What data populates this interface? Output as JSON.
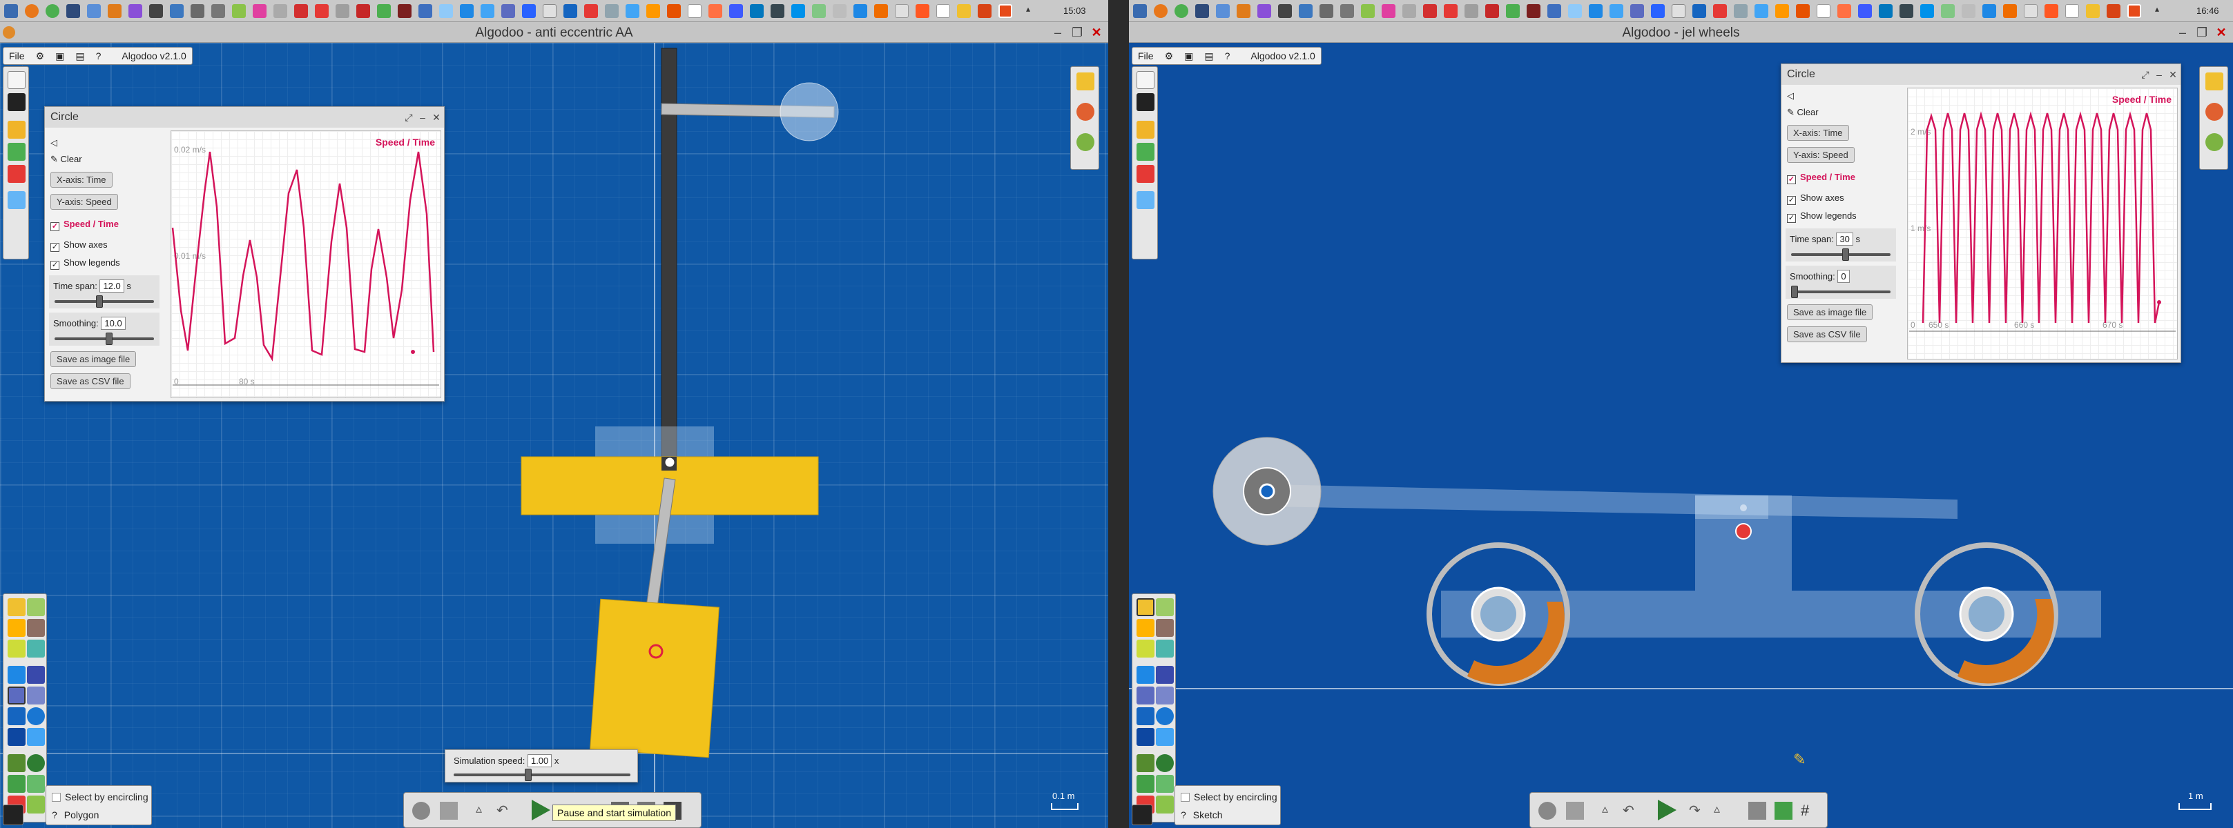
{
  "left": {
    "taskbar": {
      "clock": "15:03"
    },
    "window_title": "Algodoo - anti eccentric AA",
    "menu": {
      "file": "File",
      "version": "Algodoo v2.1.0"
    },
    "plot_panel": {
      "title": "Circle",
      "clear": "Clear",
      "xaxis_btn": "X-axis: Time",
      "yaxis_btn": "Y-axis: Speed",
      "series_check": "Speed / Time",
      "show_axes": "Show axes",
      "show_legends": "Show legends",
      "time_span_label": "Time span:",
      "time_span_value": "12.0",
      "time_span_unit": "s",
      "time_span_level": 0.45,
      "smoothing_label": "Smoothing:",
      "smoothing_value": "10.0",
      "smoothing_level": 0.55,
      "save_image": "Save as image file",
      "save_csv": "Save as CSV file",
      "legend": "Speed / Time",
      "y_tick_top": "0.02 m/s",
      "y_tick_mid": "0.01 m/s",
      "x_tick_0": "0",
      "x_tick_1": "80 s"
    },
    "sim_speed": {
      "label": "Simulation speed:",
      "value": "1.00",
      "unit": "x",
      "level": 0.42
    },
    "tooltip": "Pause and start simulation",
    "select_panel": {
      "mode": "Select by encircling",
      "tool": "Polygon"
    },
    "scale_label": "0.1 m"
  },
  "right": {
    "taskbar": {
      "clock": "16:46"
    },
    "window_title": "Algodoo - jel wheels",
    "menu": {
      "file": "File",
      "version": "Algodoo v2.1.0"
    },
    "plot_panel": {
      "title": "Circle",
      "clear": "Clear",
      "xaxis_btn": "X-axis: Time",
      "yaxis_btn": "Y-axis: Speed",
      "series_check": "Speed / Time",
      "show_axes": "Show axes",
      "show_legends": "Show legends",
      "time_span_label": "Time span:",
      "time_span_value": "30",
      "time_span_unit": "s",
      "time_span_level": 0.55,
      "smoothing_label": "Smoothing:",
      "smoothing_value": "0",
      "smoothing_level": 0.0,
      "save_image": "Save as image file",
      "save_csv": "Save as CSV file",
      "legend": "Speed / Time",
      "y_tick_top": "2 m/s",
      "y_tick_mid": "1 m/s",
      "x_ticks": [
        "0",
        "650 s",
        "660 s",
        "670 s"
      ]
    },
    "select_panel": {
      "mode": "Select by encircling",
      "tool": "Sketch"
    },
    "scale_label": "1 m"
  },
  "colors": {
    "canvas": "#0f58a6",
    "plot_line": "#d4145a",
    "yellow_body": "#f2c21a",
    "orange_jelly": "#d8781e"
  },
  "icons": [
    "file-icon",
    "gear-icon",
    "save-icon",
    "help-icon",
    "close-icon",
    "zoom-icon",
    "move-icon",
    "undo-icon",
    "redo-icon",
    "play-icon",
    "grid-icon"
  ]
}
